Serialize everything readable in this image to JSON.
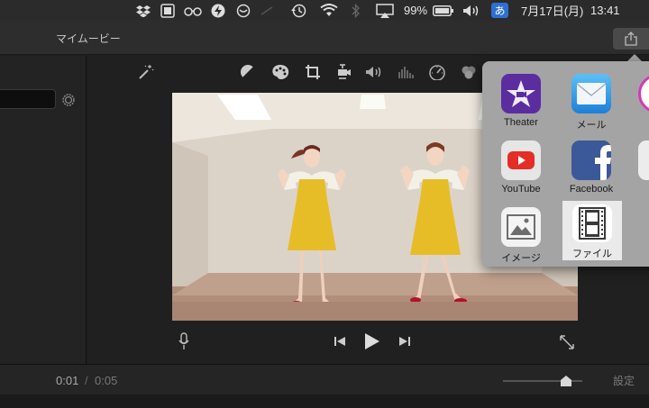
{
  "menubar": {
    "battery": "99%",
    "input_method": "あ",
    "date": "7月17日(月)",
    "time": "13:41"
  },
  "window": {
    "title": "マイムービー"
  },
  "viewer": {
    "toolbar_icons": [
      "magic-wand-icon",
      "color-balance-icon",
      "palette-icon",
      "crop-icon",
      "stabilization-icon",
      "volume-icon",
      "equalizer-icon",
      "speed-icon",
      "filter-icon"
    ]
  },
  "timeline": {
    "current": "0:01",
    "separator": "/",
    "total": "0:05",
    "settings_label": "設定",
    "zoom_level": 0.72
  },
  "share_menu": {
    "items": [
      {
        "label": "Theater",
        "icon": "theater-star-icon",
        "color": "#5b2d9e"
      },
      {
        "label": "メール",
        "icon": "mail-icon",
        "color": "#2a8fe0"
      },
      {
        "label": "YouTube",
        "icon": "youtube-icon",
        "color": "#e52d27"
      },
      {
        "label": "Facebook",
        "icon": "facebook-icon",
        "color": "#3b5998"
      },
      {
        "label": "イメージ",
        "icon": "image-icon",
        "color": "#8a8a8a"
      },
      {
        "label": "ファイル",
        "icon": "film-file-icon",
        "color": "#555555"
      }
    ],
    "selected": "ファイル"
  }
}
